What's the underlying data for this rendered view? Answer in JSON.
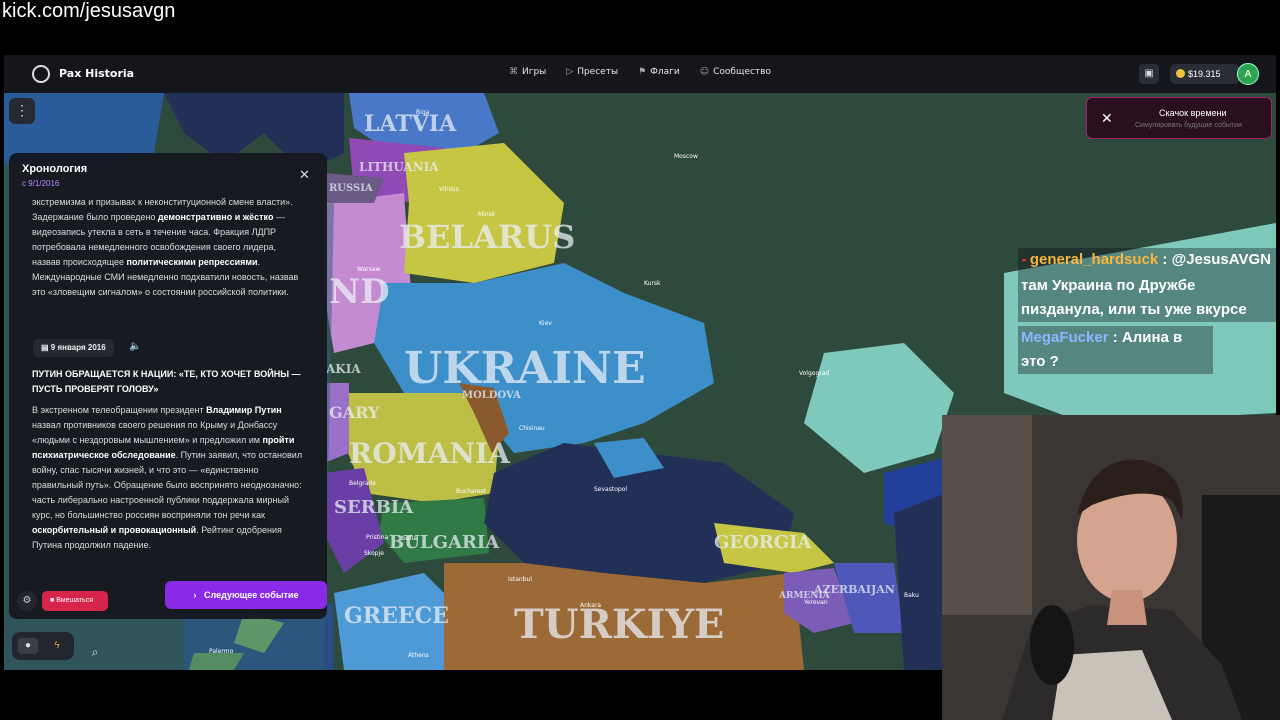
{
  "stream": {
    "url": "kick.com/jesusavgn"
  },
  "app": {
    "brand": "Pax Historia",
    "nav": [
      {
        "icon": "gamepad-icon",
        "label": "Игры"
      },
      {
        "icon": "play-icon",
        "label": "Пресеты"
      },
      {
        "icon": "flag-icon",
        "label": "Флаги"
      },
      {
        "icon": "users-icon",
        "label": "Сообщество"
      }
    ],
    "balance": "$19.315",
    "avatar_letter": "A"
  },
  "timeline": {
    "title": "Хронология",
    "date": "с 9/1/2016",
    "event_date": "9 января 2016",
    "headline": "ПУТИН ОБРАЩАЕТСЯ К НАЦИИ: «ТЕ, КТО ХОЧЕТ ВОЙНЫ — ПУСТЬ ПРОВЕРЯТ ГОЛОВУ»",
    "intervene_label": "Вмешаться",
    "next_label": "Следующее событие"
  },
  "time_skip": {
    "title": "Скачок времени",
    "subtitle": "Симулировать будущие события"
  },
  "map_labels": {
    "countries": [
      "LATVIA",
      "LITHUANIA",
      "BELARUS",
      "UKRAINE",
      "ROMANIA",
      "MOLDOVA",
      "BULGARIA",
      "SERBIA",
      "GREECE",
      "TURKIYE",
      "GEORGIA",
      "ARMENIA",
      "AZERBAIJAN",
      "RUSSIA",
      "ND",
      "GARY",
      "AKIA"
    ],
    "cities": [
      "Moscow",
      "Kursk",
      "Volgograd",
      "Kiev",
      "Minsk",
      "Riga",
      "Vilnius",
      "Warsaw",
      "Sevastopol",
      "Chisinau",
      "Bucharest",
      "Belgrade",
      "Sofia",
      "Skopje",
      "Pristina",
      "Istanbul",
      "Ankara",
      "Athens",
      "Yerevan",
      "Baku",
      "Palermo"
    ]
  },
  "chat": [
    {
      "user": "general_hardsuck",
      "message": "@JesusAVGN там Украина по Дружбе пизданула, или ты уже вкурсе"
    },
    {
      "user": "MegaFucker",
      "message": "Алина в это ?"
    }
  ],
  "colors": {
    "ukraine": "#3d8fc9",
    "belarus": "#c7c544",
    "romania": "#bdbe45",
    "turkiye": "#9b6a36",
    "russia": "#2f4a3e",
    "sea": "#223058",
    "accent": "#8a2ae6",
    "intervene": "#d7244a"
  }
}
